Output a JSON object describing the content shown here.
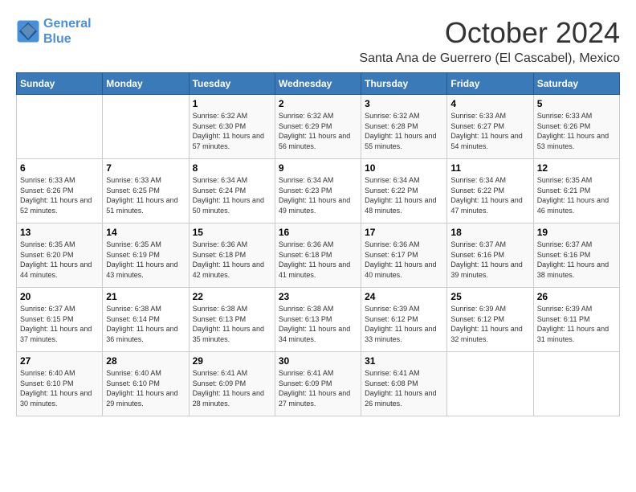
{
  "logo": {
    "line1": "General",
    "line2": "Blue"
  },
  "title": "October 2024",
  "location": "Santa Ana de Guerrero (El Cascabel), Mexico",
  "days_of_week": [
    "Sunday",
    "Monday",
    "Tuesday",
    "Wednesday",
    "Thursday",
    "Friday",
    "Saturday"
  ],
  "weeks": [
    [
      {
        "day": "",
        "info": ""
      },
      {
        "day": "",
        "info": ""
      },
      {
        "day": "1",
        "info": "Sunrise: 6:32 AM\nSunset: 6:30 PM\nDaylight: 11 hours and 57 minutes."
      },
      {
        "day": "2",
        "info": "Sunrise: 6:32 AM\nSunset: 6:29 PM\nDaylight: 11 hours and 56 minutes."
      },
      {
        "day": "3",
        "info": "Sunrise: 6:32 AM\nSunset: 6:28 PM\nDaylight: 11 hours and 55 minutes."
      },
      {
        "day": "4",
        "info": "Sunrise: 6:33 AM\nSunset: 6:27 PM\nDaylight: 11 hours and 54 minutes."
      },
      {
        "day": "5",
        "info": "Sunrise: 6:33 AM\nSunset: 6:26 PM\nDaylight: 11 hours and 53 minutes."
      }
    ],
    [
      {
        "day": "6",
        "info": "Sunrise: 6:33 AM\nSunset: 6:26 PM\nDaylight: 11 hours and 52 minutes."
      },
      {
        "day": "7",
        "info": "Sunrise: 6:33 AM\nSunset: 6:25 PM\nDaylight: 11 hours and 51 minutes."
      },
      {
        "day": "8",
        "info": "Sunrise: 6:34 AM\nSunset: 6:24 PM\nDaylight: 11 hours and 50 minutes."
      },
      {
        "day": "9",
        "info": "Sunrise: 6:34 AM\nSunset: 6:23 PM\nDaylight: 11 hours and 49 minutes."
      },
      {
        "day": "10",
        "info": "Sunrise: 6:34 AM\nSunset: 6:22 PM\nDaylight: 11 hours and 48 minutes."
      },
      {
        "day": "11",
        "info": "Sunrise: 6:34 AM\nSunset: 6:22 PM\nDaylight: 11 hours and 47 minutes."
      },
      {
        "day": "12",
        "info": "Sunrise: 6:35 AM\nSunset: 6:21 PM\nDaylight: 11 hours and 46 minutes."
      }
    ],
    [
      {
        "day": "13",
        "info": "Sunrise: 6:35 AM\nSunset: 6:20 PM\nDaylight: 11 hours and 44 minutes."
      },
      {
        "day": "14",
        "info": "Sunrise: 6:35 AM\nSunset: 6:19 PM\nDaylight: 11 hours and 43 minutes."
      },
      {
        "day": "15",
        "info": "Sunrise: 6:36 AM\nSunset: 6:18 PM\nDaylight: 11 hours and 42 minutes."
      },
      {
        "day": "16",
        "info": "Sunrise: 6:36 AM\nSunset: 6:18 PM\nDaylight: 11 hours and 41 minutes."
      },
      {
        "day": "17",
        "info": "Sunrise: 6:36 AM\nSunset: 6:17 PM\nDaylight: 11 hours and 40 minutes."
      },
      {
        "day": "18",
        "info": "Sunrise: 6:37 AM\nSunset: 6:16 PM\nDaylight: 11 hours and 39 minutes."
      },
      {
        "day": "19",
        "info": "Sunrise: 6:37 AM\nSunset: 6:16 PM\nDaylight: 11 hours and 38 minutes."
      }
    ],
    [
      {
        "day": "20",
        "info": "Sunrise: 6:37 AM\nSunset: 6:15 PM\nDaylight: 11 hours and 37 minutes."
      },
      {
        "day": "21",
        "info": "Sunrise: 6:38 AM\nSunset: 6:14 PM\nDaylight: 11 hours and 36 minutes."
      },
      {
        "day": "22",
        "info": "Sunrise: 6:38 AM\nSunset: 6:13 PM\nDaylight: 11 hours and 35 minutes."
      },
      {
        "day": "23",
        "info": "Sunrise: 6:38 AM\nSunset: 6:13 PM\nDaylight: 11 hours and 34 minutes."
      },
      {
        "day": "24",
        "info": "Sunrise: 6:39 AM\nSunset: 6:12 PM\nDaylight: 11 hours and 33 minutes."
      },
      {
        "day": "25",
        "info": "Sunrise: 6:39 AM\nSunset: 6:12 PM\nDaylight: 11 hours and 32 minutes."
      },
      {
        "day": "26",
        "info": "Sunrise: 6:39 AM\nSunset: 6:11 PM\nDaylight: 11 hours and 31 minutes."
      }
    ],
    [
      {
        "day": "27",
        "info": "Sunrise: 6:40 AM\nSunset: 6:10 PM\nDaylight: 11 hours and 30 minutes."
      },
      {
        "day": "28",
        "info": "Sunrise: 6:40 AM\nSunset: 6:10 PM\nDaylight: 11 hours and 29 minutes."
      },
      {
        "day": "29",
        "info": "Sunrise: 6:41 AM\nSunset: 6:09 PM\nDaylight: 11 hours and 28 minutes."
      },
      {
        "day": "30",
        "info": "Sunrise: 6:41 AM\nSunset: 6:09 PM\nDaylight: 11 hours and 27 minutes."
      },
      {
        "day": "31",
        "info": "Sunrise: 6:41 AM\nSunset: 6:08 PM\nDaylight: 11 hours and 26 minutes."
      },
      {
        "day": "",
        "info": ""
      },
      {
        "day": "",
        "info": ""
      }
    ]
  ]
}
